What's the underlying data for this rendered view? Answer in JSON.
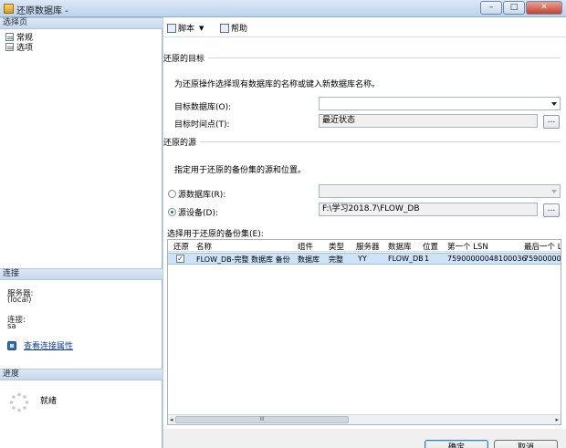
{
  "window": {
    "title": "还原数据库 -",
    "min": "–",
    "max": "□",
    "close": "✕"
  },
  "left": {
    "select_page_header": "选择页",
    "pages": [
      {
        "label": "常规"
      },
      {
        "label": "选项"
      }
    ],
    "connection_header": "连接",
    "server_label": "服务器:",
    "server_value": "(local)",
    "connection_label": "连接:",
    "connection_value": "sa",
    "view_link": "查看连接属性",
    "progress_header": "进度",
    "progress_status": "就绪"
  },
  "toolbar": {
    "script": "脚本",
    "help": "帮助"
  },
  "target": {
    "group": "还原的目标",
    "desc": "为还原操作选择现有数据库的名称或键入新数据库名称。",
    "db_label": "目标数据库(O):",
    "db_value": "",
    "time_label": "目标时间点(T):",
    "time_value": "最近状态",
    "browse": "..."
  },
  "source": {
    "group": "还原的源",
    "desc": "指定用于还原的备份集的源和位置。",
    "from_db_label": "源数据库(R):",
    "from_db_value": "",
    "from_device_label": "源设备(D):",
    "from_device_value": "F:\\学习2018.7\\FLOW_DB",
    "browse": "..."
  },
  "backup_sets": {
    "label": "选择用于还原的备份集(E):",
    "columns": [
      "还原",
      "名称",
      "组件",
      "类型",
      "服务器",
      "数据库",
      "位置",
      "第一个 LSN",
      "最后一个 L"
    ],
    "rows": [
      {
        "checked": "✓",
        "name": "FLOW_DB-完整 数据库 备份",
        "component": "数据库",
        "type": "完整",
        "server": "YY",
        "database": "FLOW_DB",
        "position": "1",
        "first_lsn": "75900000048100036",
        "last_lsn": "759000000"
      }
    ],
    "scroll_left": "◂",
    "scroll_right": "▸",
    "scroll_grip": "III"
  },
  "buttons": {
    "ok": "确定",
    "cancel": "取消"
  }
}
